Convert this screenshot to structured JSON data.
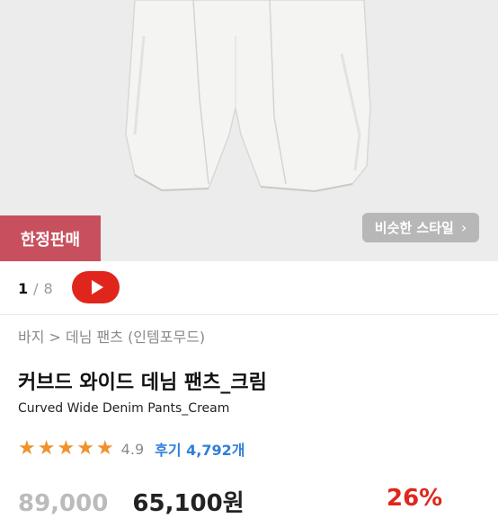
{
  "badge": {
    "label": "한정판매"
  },
  "similar_style": {
    "label": "비슷한 스타일",
    "icon": "chevron-right-icon"
  },
  "gallery": {
    "current": "1",
    "separator": "/",
    "total": "8"
  },
  "video_button": {
    "icon": "play-icon",
    "color": "#e0261c"
  },
  "breadcrumb": "바지 > 데님 팬츠 (인템포무드)",
  "product": {
    "title": "커브드 와이드 데님 팬츠_크림",
    "subtitle": "Curved Wide Denim Pants_Cream"
  },
  "rating": {
    "score": "4.9",
    "stars": 5,
    "review_label": "후기",
    "review_count": "4,792개"
  },
  "price": {
    "original_partial": "89,000",
    "sale_partial": "65,100원",
    "discount_partial": "26%"
  },
  "colors": {
    "accent_red": "#e0261c",
    "badge": "#c8505e",
    "star": "#f0912c",
    "link": "#2f7fd8"
  }
}
